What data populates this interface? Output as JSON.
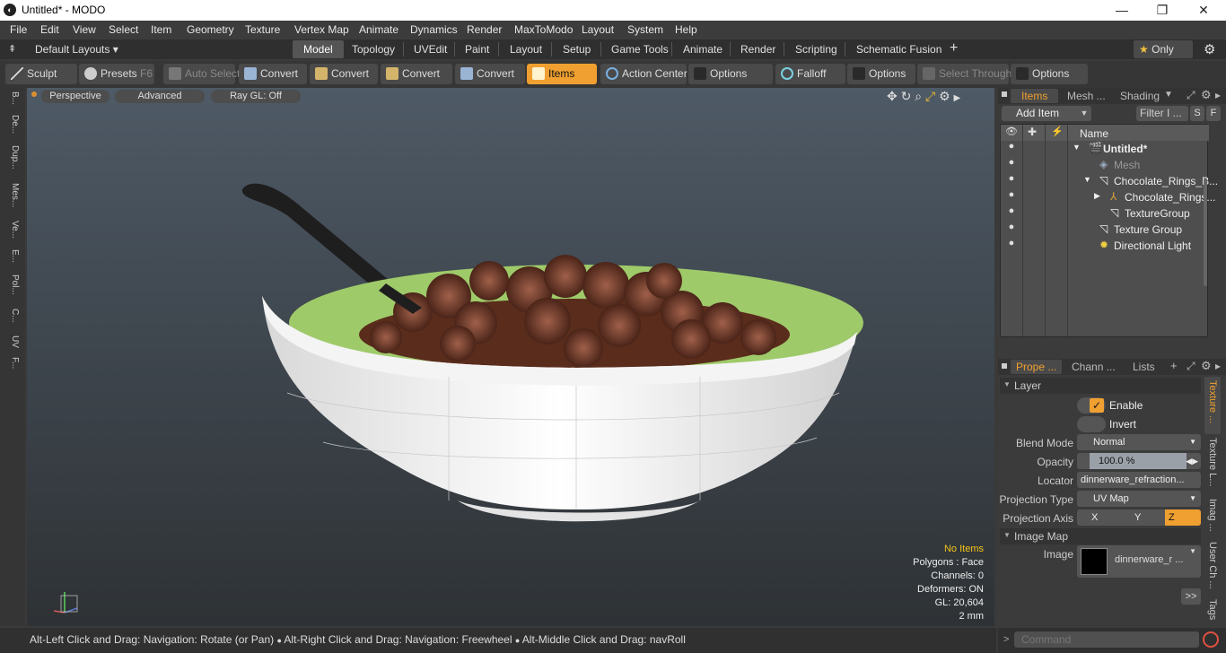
{
  "window": {
    "title": "Untitled* - MODO"
  },
  "menubar": [
    "File",
    "Edit",
    "View",
    "Select",
    "Item",
    "Geometry",
    "Texture",
    "Vertex Map",
    "Animate",
    "Dynamics",
    "Render",
    "MaxToModo",
    "Layout",
    "System",
    "Help"
  ],
  "layout_selector": "Default Layouts",
  "tabs": [
    "Model",
    "Topology",
    "UVEdit",
    "Paint",
    "Layout",
    "Setup",
    "Game Tools",
    "Animate",
    "Render",
    "Scripting",
    "Schematic Fusion"
  ],
  "only_label": "Only",
  "toolbar": {
    "sculpt": "Sculpt",
    "presets": "Presets",
    "presets_key": "F6",
    "auto_select": "Auto Select",
    "convert": "Convert",
    "items": "Items",
    "action_center": "Action Center",
    "options": "Options",
    "falloff": "Falloff",
    "select_through": "Select Through"
  },
  "left_tabs": [
    "B...",
    "De...",
    "Dup...",
    "Mes...",
    "Ve...",
    "E...",
    "Pol...",
    "C...",
    "UV",
    "F..."
  ],
  "viewport": {
    "perspective": "Perspective",
    "advanced": "Advanced",
    "raygl": "Ray GL: Off",
    "info": {
      "no_items": "No Items",
      "polygons": "Polygons : Face",
      "channels": "Channels: 0",
      "deformers": "Deformers: ON",
      "gl": "GL: 20,604",
      "scale": "2 mm"
    }
  },
  "status": {
    "hint1": "Alt-Left Click and Drag: Navigation: Rotate (or Pan)",
    "hint2": "Alt-Right Click and Drag: Navigation: Freewheel",
    "hint3": "Alt-Middle Click and Drag: navRoll"
  },
  "item_panel": {
    "tabs": [
      "Items",
      "Mesh ...",
      "Shading"
    ],
    "add_item": "Add Item",
    "filter": "Filter I ...",
    "s_btn": "S",
    "f_btn": "F",
    "name_header": "Name",
    "items": [
      {
        "label": "Untitled*",
        "bold": true
      },
      {
        "label": "Mesh",
        "dim": true
      },
      {
        "label": "Chocolate_Rings_B..."
      },
      {
        "label": "Chocolate_Rings..."
      },
      {
        "label": "TextureGroup"
      },
      {
        "label": "Texture Group"
      },
      {
        "label": "Directional Light"
      }
    ]
  },
  "props_panel": {
    "tabs": [
      "Prope ...",
      "Chann ...",
      "Lists"
    ],
    "section_layer": "Layer",
    "enable": "Enable",
    "invert": "Invert",
    "blend_mode_label": "Blend Mode",
    "blend_mode": "Normal",
    "opacity_label": "Opacity",
    "opacity": "100.0 %",
    "locator_label": "Locator",
    "locator": "dinnerware_refraction...",
    "projection_type_label": "Projection Type",
    "projection_type": "UV Map",
    "projection_axis_label": "Projection Axis",
    "axis_x": "X",
    "axis_y": "Y",
    "axis_z": "Z",
    "section_image_map": "Image Map",
    "image_label": "Image",
    "image_value": "dinnerware_r ...",
    "expand": ">>",
    "side_tabs": [
      "Texture ...",
      "Texture L...",
      "Imag ...",
      "User Ch ...",
      "Tags"
    ]
  },
  "command_placeholder": "Command"
}
